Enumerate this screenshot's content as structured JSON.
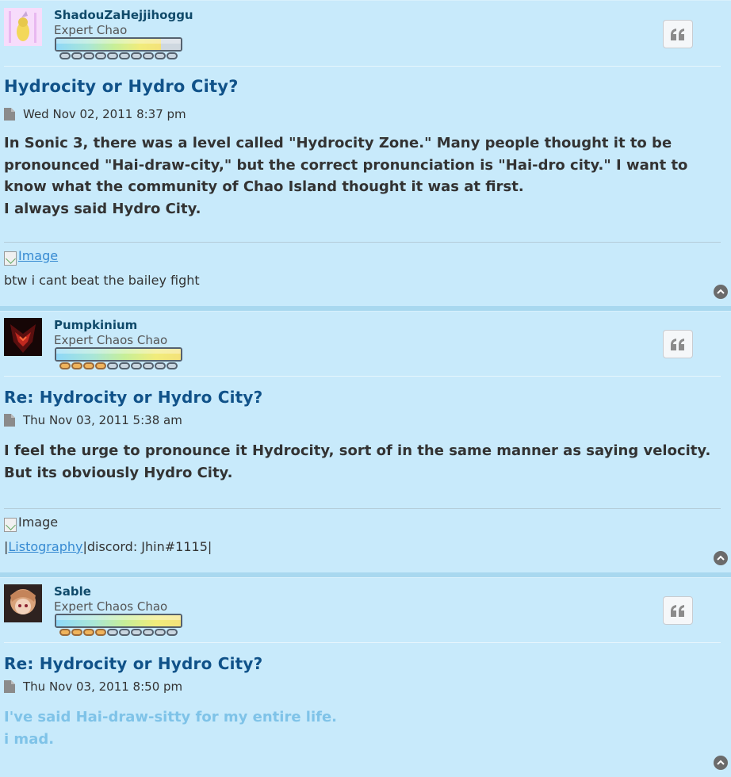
{
  "posts": [
    {
      "username": "ShadouZaHejjihoggu",
      "rank": "Expert Chao",
      "rank_fill": 0.84,
      "pills_on": 0,
      "title": "Hydrocity or Hydro City?",
      "date": "Wed Nov 02, 2011 8:37 pm",
      "content": [
        "In Sonic 3, there was a level called \"Hydrocity Zone.\" Many people thought it to be",
        "pronounced \"Hai-draw-city,\" but the correct pronunciation is \"Hai-dro city.\" I want to",
        "know what the community of Chao Island thought it was at first.",
        "I always said Hydro City."
      ],
      "sig_image_alt": "Image",
      "sig_text": "btw i cant beat the bailey fight"
    },
    {
      "username": "Pumpkinium",
      "rank": "Expert Chaos Chao",
      "rank_fill": 1.0,
      "pills_on": 4,
      "title": "Re: Hydrocity or Hydro City?",
      "date": "Thu Nov 03, 2011 5:38 am",
      "content": [
        "I feel the urge to pronounce it Hydrocity, sort of in the same manner as saying velocity.",
        "But its obviously Hydro City."
      ],
      "sig_image_alt": "Image",
      "sig_pipe1": "|",
      "sig_link": "Listography",
      "sig_rest": "|discord: Jhin#1115|"
    },
    {
      "username": "Sable",
      "rank": "Expert Chaos Chao",
      "rank_fill": 1.0,
      "pills_on": 4,
      "title": "Re: Hydrocity or Hydro City?",
      "date": "Thu Nov 03, 2011 8:50 pm",
      "content": [
        "I've said Hai-draw-sitty for my entire life.",
        "i mad."
      ]
    }
  ],
  "icons": {
    "quote": "quote-icon",
    "post": "post-icon",
    "top": "back-to-top-icon"
  },
  "colors": {
    "title": "#105289",
    "username": "#104a6a",
    "link": "#368ad2",
    "light_text": "#7fc3e8"
  }
}
